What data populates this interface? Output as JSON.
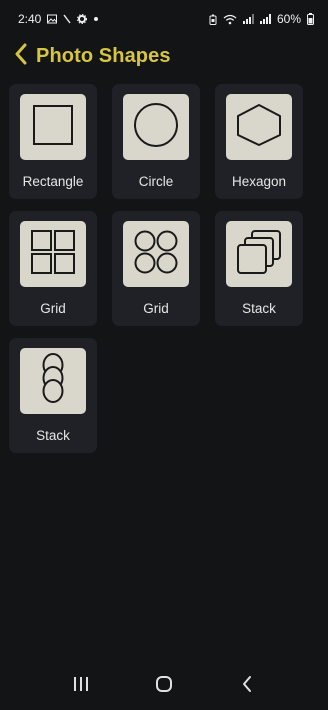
{
  "status": {
    "time": "2:40",
    "battery": "60%",
    "left_icons": [
      "image-icon",
      "pen-icon",
      "gear-icon",
      "dot-icon"
    ],
    "right_icons": [
      "battery-saver-icon",
      "wifi-icon",
      "signal-icon",
      "signal-icon"
    ]
  },
  "header": {
    "title": "Photo Shapes",
    "back_icon": "chevron-left-icon",
    "title_color": "#d8c53f"
  },
  "shapes": [
    {
      "label": "Rectangle",
      "icon": "rectangle-icon"
    },
    {
      "label": "Circle",
      "icon": "circle-icon"
    },
    {
      "label": "Hexagon",
      "icon": "hexagon-icon"
    },
    {
      "label": "Grid",
      "icon": "square-grid-icon"
    },
    {
      "label": "Grid",
      "icon": "circle-grid-icon"
    },
    {
      "label": "Stack",
      "icon": "square-stack-icon"
    },
    {
      "label": "Stack",
      "icon": "circle-stack-icon"
    }
  ],
  "nav": {
    "icons": [
      "recent-apps-icon",
      "home-icon",
      "back-icon"
    ]
  },
  "colors": {
    "background": "#121416",
    "tile": "#1f2127",
    "thumb": "#d9d6cc",
    "accent": "#d8c53f"
  }
}
